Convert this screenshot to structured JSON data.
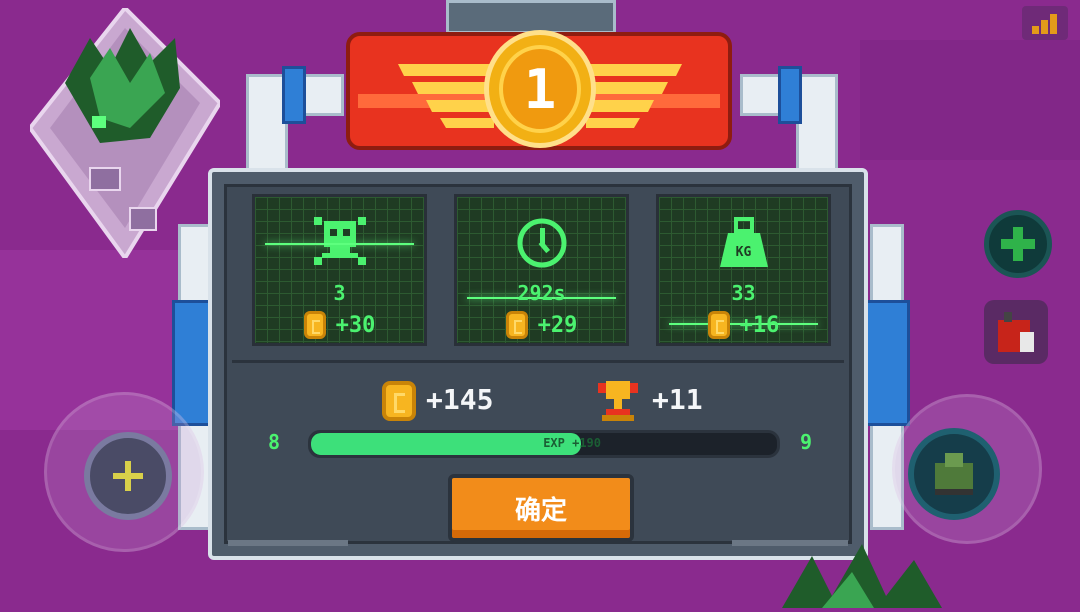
{
  "banner": {
    "rank": "1"
  },
  "stats": [
    {
      "icon": "skull-crossbones-icon",
      "value": "3",
      "reward": "+30"
    },
    {
      "icon": "clock-icon",
      "value": "292s",
      "reward": "+29"
    },
    {
      "icon": "weight-icon",
      "value": "33",
      "reward": "+16",
      "icon_text": "KG"
    }
  ],
  "totals": {
    "gold": "+145",
    "trophy": "+11"
  },
  "level": {
    "current": "8",
    "next": "9",
    "exp_label": "EXP +190",
    "progress": 0.58
  },
  "confirm_label": "确定",
  "colors": {
    "background": "#8a2a8e",
    "accent_green": "#4bf26f",
    "button": "#f28c1a"
  }
}
